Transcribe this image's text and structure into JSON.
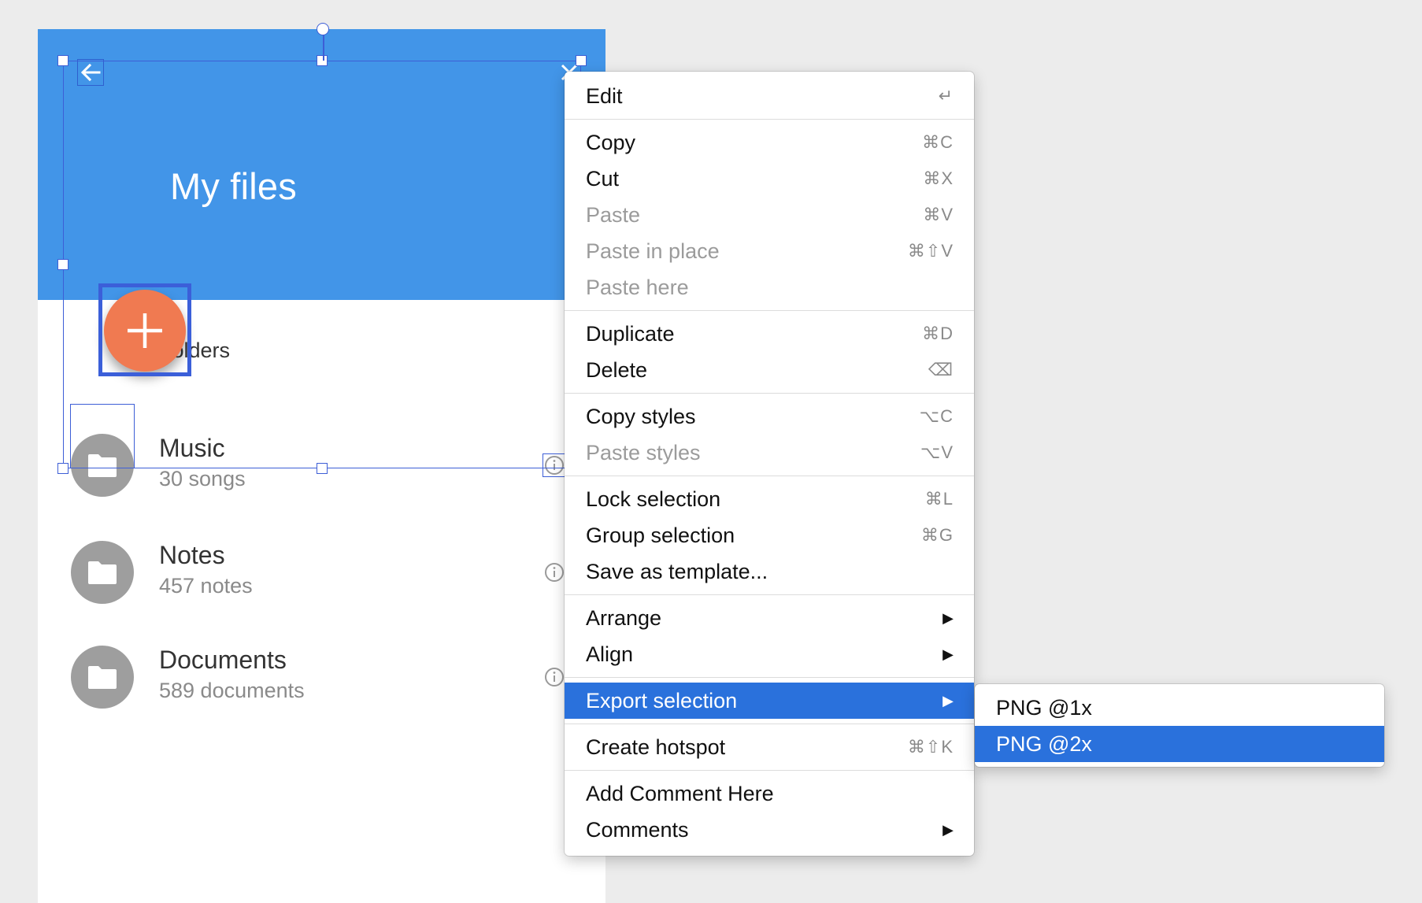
{
  "appbar": {
    "title": "My files"
  },
  "list": {
    "header": "Folders",
    "items": [
      {
        "title": "Music",
        "subtitle": "30 songs"
      },
      {
        "title": "Notes",
        "subtitle": "457 notes"
      },
      {
        "title": "Documents",
        "subtitle": "589 documents"
      }
    ]
  },
  "context_menu": {
    "items": [
      {
        "label": "Edit",
        "shortcut": "↵"
      },
      {
        "label": "Copy",
        "shortcut": "⌘C"
      },
      {
        "label": "Cut",
        "shortcut": "⌘X"
      },
      {
        "label": "Paste",
        "shortcut": "⌘V",
        "disabled": true
      },
      {
        "label": "Paste in place",
        "shortcut": "⌘⇧V",
        "disabled": true
      },
      {
        "label": "Paste here",
        "disabled": true
      },
      {
        "label": "Duplicate",
        "shortcut": "⌘D"
      },
      {
        "label": "Delete",
        "shortcut": "⌫"
      },
      {
        "label": "Copy styles",
        "shortcut": "⌥C"
      },
      {
        "label": "Paste styles",
        "shortcut": "⌥V",
        "disabled": true
      },
      {
        "label": "Lock selection",
        "shortcut": "⌘L"
      },
      {
        "label": "Group selection",
        "shortcut": "⌘G"
      },
      {
        "label": "Save as template..."
      },
      {
        "label": "Arrange",
        "submenu": true
      },
      {
        "label": "Align",
        "submenu": true
      },
      {
        "label": "Export selection",
        "submenu": true,
        "highlighted": true
      },
      {
        "label": "Create hotspot",
        "shortcut": "⌘⇧K"
      },
      {
        "label": "Add Comment Here"
      },
      {
        "label": "Comments",
        "submenu": true
      }
    ],
    "arrow_glyph": "▶"
  },
  "export_submenu": {
    "items": [
      {
        "label": "PNG @1x"
      },
      {
        "label": "PNG @2x",
        "highlighted": true
      }
    ]
  },
  "colors": {
    "appbar": "#4295e8",
    "fab": "#f07a51",
    "selection": "#3d5ed6",
    "menu_highlight": "#2a71dc",
    "folder_avatar": "#9e9e9e"
  }
}
